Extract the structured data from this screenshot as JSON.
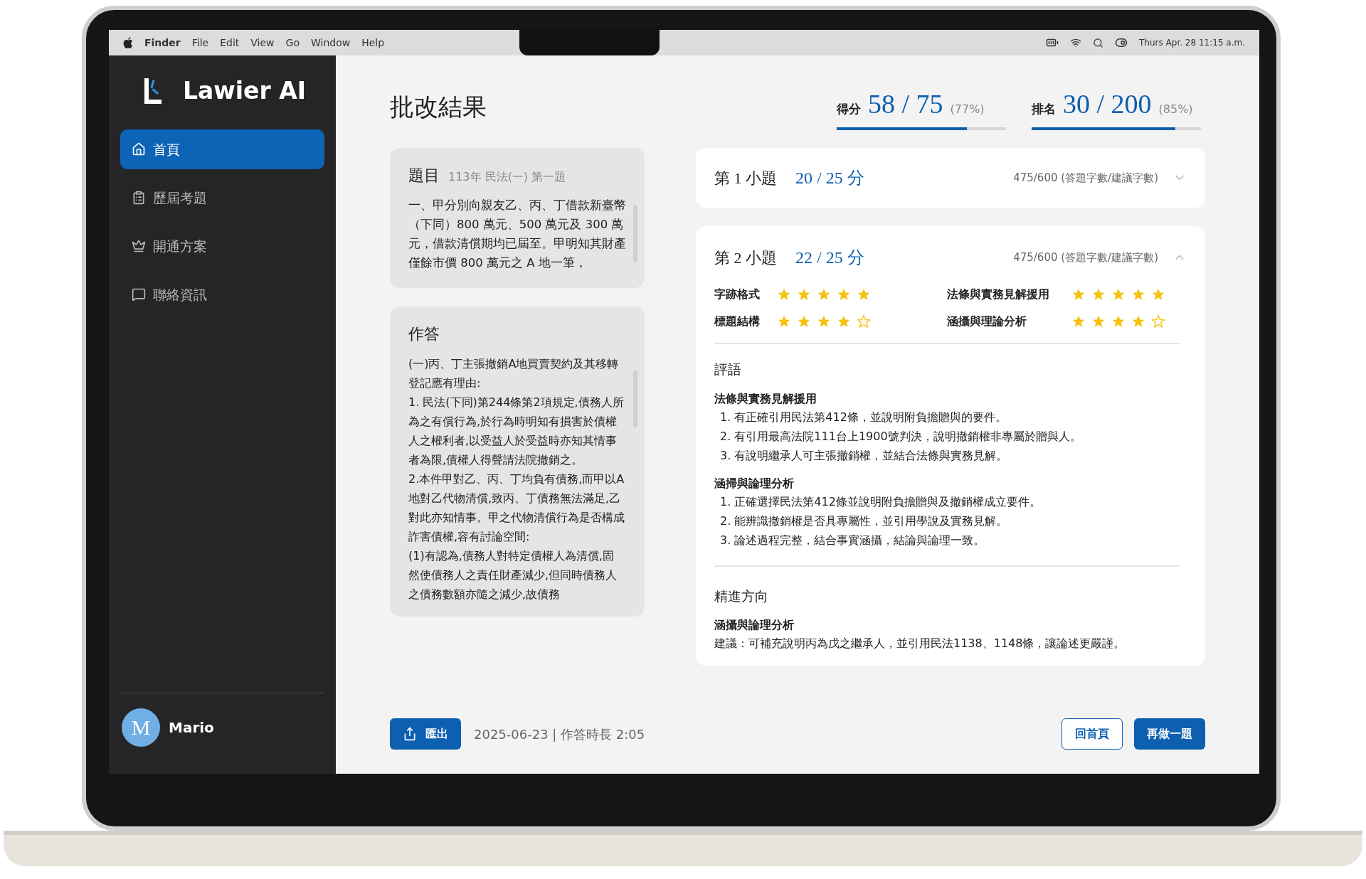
{
  "menu_bar": {
    "app": "Finder",
    "menus": [
      "File",
      "Edit",
      "View",
      "Go",
      "Window",
      "Help"
    ],
    "clock": "Thurs Apr. 28 11:15 a.m."
  },
  "sidebar": {
    "brand": "Lawier AI",
    "items": [
      {
        "label": "首頁",
        "selected": true
      },
      {
        "label": "歷屆考題",
        "selected": false
      },
      {
        "label": "開通方案",
        "selected": false
      },
      {
        "label": "聯絡資訊",
        "selected": false
      }
    ],
    "user": {
      "initial": "M",
      "name": "Mario"
    }
  },
  "page_title": "批改結果",
  "metrics": [
    {
      "label": "得分",
      "value": "58 / 75",
      "percent": "(77%)",
      "level": 0.77
    },
    {
      "label": "排名",
      "value": "30 / 200",
      "percent": "(85%)",
      "level": 0.85
    }
  ],
  "question": {
    "heading": "題目",
    "meta": "113年 民法(一) 第一題",
    "text": "一、甲分別向親友乙、丙、丁借款新臺幣（下同）800 萬元、500 萬元及 300 萬元，借款清償期均已屆至。甲明知其財產僅餘市價 800 萬元之 A 地一筆，"
  },
  "answer": {
    "heading": "作答",
    "paragraphs": [
      "(一)丙、丁主張撤銷A地買賣契約及其移轉登記應有理由:",
      "1. 民法(下同)第244條第2項規定,債務人所為之有償行為,於行為時明知有損害於債權人之權利者,以受益人於受益時亦知其情事者為限,債權人得聲請法院撤銷之。",
      "2.本件甲對乙、丙、丁均負有債務,而甲以A地對乙代物清償,致丙、丁債務無法滿足,乙對此亦知情事。甲之代物清償行為是否構成詐害債權,容有討論空間:",
      "(1)有認為,債務人對特定債權人為清償,固然使債務人之責任財產減少,但同時債務人之債務數額亦隨之減少,故債務"
    ]
  },
  "subquestions": [
    {
      "title": "第 1 小題",
      "score": "20 / 25 分",
      "word_count": "475/600 (答題字數/建議字數)",
      "expanded": false
    },
    {
      "title": "第 2 小題",
      "score": "22 / 25 分",
      "word_count": "475/600 (答題字數/建議字數)",
      "expanded": true,
      "ratings": [
        {
          "label": "字跡格式",
          "stars": 5
        },
        {
          "label": "法條與實務見解援用",
          "stars": 5
        },
        {
          "label": "標題結構",
          "stars": 4
        },
        {
          "label": "涵攝與理論分析",
          "stars": 4
        }
      ],
      "comments": {
        "heading": "評語",
        "sections": [
          {
            "title": "法條與實務見解援用",
            "items": [
              "1. 有正確引用民法第412條，並說明附負擔贈與的要件。",
              "2. 有引用最高法院111台上1900號判決，說明撤銷權非專屬於贈與人。",
              "3. 有說明繼承人可主張撤銷權，並結合法條與實務見解。"
            ]
          },
          {
            "title": "涵掃與論理分析",
            "items": [
              "1. 正確選擇民法第412條並說明附負擔贈與及撤銷權成立要件。",
              "2. 能辨識撤銷權是否具專屬性，並引用學說及實務見解。",
              "3. 論述過程完整，結合事實涵攝，結論與論理一致。"
            ]
          }
        ]
      },
      "improvement": {
        "heading": "精進方向",
        "sections": [
          {
            "title": "涵攝與論理分析",
            "text": "建議：可補充說明丙為戊之繼承人，並引用民法1138、1148條，讓論述更嚴謹。"
          }
        ]
      }
    }
  ],
  "footer": {
    "export": "匯出",
    "meta": "2025-06-23 | 作答時長 2:05",
    "buttons": [
      {
        "label": "回首頁",
        "kind": "outline"
      },
      {
        "label": "再做一題",
        "kind": "primary"
      }
    ]
  }
}
